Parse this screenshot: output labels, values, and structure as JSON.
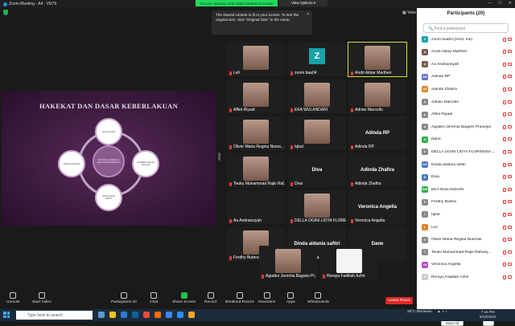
{
  "window": {
    "title": "Zoom Meeting - A4 - VR79",
    "viewing_banner": "You are viewing Andri Akbar Marthen's screen",
    "view_options": "View Options ▾",
    "controls": [
      "—",
      "☐",
      "✕"
    ],
    "view_label": "View"
  },
  "toast": {
    "message": "The shared content is fit to your screen. To see the original size, click \"Original Size\" in the menu.",
    "close": "✕"
  },
  "slide": {
    "title": "HAKEKAT DAN DASAR KEBERLAKUAN",
    "center_node": "PANCASILA SEBAGAI IDEOLOGI BERBANGSA",
    "nodes": [
      "NILAI DASAR",
      "SUMBER HUKUM NEGARA",
      "PANDANGAN HIDUP",
      "DASAR NEGARA"
    ]
  },
  "tiles": [
    {
      "name": "Leli",
      "kind": "photo"
    },
    {
      "name": "zoom baa04",
      "kind": "zavatar",
      "initial": "Z"
    },
    {
      "name": "Andri Akbar Marthen",
      "kind": "photo",
      "active": true
    },
    {
      "name": "Affiet Riyadi",
      "kind": "photo"
    },
    {
      "name": "EKA WULANDARI",
      "kind": "photo"
    },
    {
      "name": "Adrian Marcello",
      "kind": "photo"
    },
    {
      "name": "Oliver Maria Regina Noers...",
      "kind": "photo"
    },
    {
      "name": "Iqbal",
      "kind": "photo"
    },
    {
      "name": "Adinda RP",
      "kind": "text"
    },
    {
      "name": "Teuku Muhammad Rajiv Raf...",
      "kind": "photo"
    },
    {
      "name": "Diva",
      "kind": "text"
    },
    {
      "name": "Adinda Zhafira",
      "kind": "text"
    },
    {
      "name": "Aa Andriansyah",
      "kind": "blank"
    },
    {
      "name": "DELLA OGINI LIDYA FLORE...",
      "kind": "photo"
    },
    {
      "name": "Veronica Angella",
      "kind": "text"
    },
    {
      "name": "Ferdhy Butera",
      "kind": "photo"
    },
    {
      "name": "Dinda aldania safitri",
      "kind": "text"
    },
    {
      "name": "Dane",
      "kind": "text"
    },
    {
      "name": "Agadeo Jeremia Bagoes Pr...",
      "kind": "photo"
    },
    {
      "name": "Rerayu Fadillah Azhri",
      "kind": "white"
    }
  ],
  "toolbar": {
    "unmute": "Unmute",
    "start_video": "Start Video",
    "participants": "Participants",
    "participants_count": "20",
    "chat": "Chat",
    "share_screen": "Share Screen",
    "record": "Record",
    "breakout_rooms": "Breakout Rooms",
    "reactions": "Reactions",
    "apps": "Apps",
    "whiteboards": "Whiteboards",
    "leave": "Leave Room"
  },
  "panel": {
    "title": "Participants (20)",
    "search_placeholder": "Find a participant",
    "participants": [
      {
        "name": "zoom baa04 (Host, me)",
        "initial": "Z",
        "color": "#19a2a8"
      },
      {
        "name": "Andri Akbar Marthen",
        "initial": "A",
        "color": "#7a5a4a"
      },
      {
        "name": "Aa Andriansyah",
        "initial": "A",
        "color": "#7a5a4a"
      },
      {
        "name": "Adinda RP",
        "initial": "AR",
        "color": "#6a6fc7"
      },
      {
        "name": "Adinda Zhafira",
        "initial": "AZ",
        "color": "#e2822a"
      },
      {
        "name": "Adrian Marcello",
        "initial": "A",
        "color": "#888"
      },
      {
        "name": "Affiet Riyadi",
        "initial": "A",
        "color": "#888"
      },
      {
        "name": "Agadeo Jeremia Bagoes Prasetyo",
        "initial": "A",
        "color": "#888"
      },
      {
        "name": "Dane",
        "initial": "D",
        "color": "#2fae4e"
      },
      {
        "name": "DELLA OGINI LIDYA FLORENSIA ...",
        "initial": "D",
        "color": "#888"
      },
      {
        "name": "Dinda aldania safitri",
        "initial": "DA",
        "color": "#4a78c7"
      },
      {
        "name": "Diva",
        "initial": "D",
        "color": "#4a78c7"
      },
      {
        "name": "EKA WULANDARI",
        "initial": "EW",
        "color": "#2fae4e"
      },
      {
        "name": "Ferdhy Butera",
        "initial": "F",
        "color": "#888"
      },
      {
        "name": "Iqbal",
        "initial": "I",
        "color": "#888"
      },
      {
        "name": "Leli",
        "initial": "L",
        "color": "#e2822a"
      },
      {
        "name": "Oliver Maria Regina Noersali",
        "initial": "O",
        "color": "#888"
      },
      {
        "name": "Teuku Muhammad Rajiv Rafsanj...",
        "initial": "T",
        "color": "#888"
      },
      {
        "name": "Veronica Angella",
        "initial": "VA",
        "color": "#b44ac7"
      },
      {
        "name": "Rerayu Fadillah Azhri",
        "initial": "R",
        "color": "#ccc"
      }
    ],
    "mute_all": "Mute All",
    "more": "···"
  },
  "taskbar": {
    "search_placeholder": "Type here to search",
    "weather": "28°C Berawan",
    "time": "7:16 PM",
    "date": "9/23/2022"
  }
}
